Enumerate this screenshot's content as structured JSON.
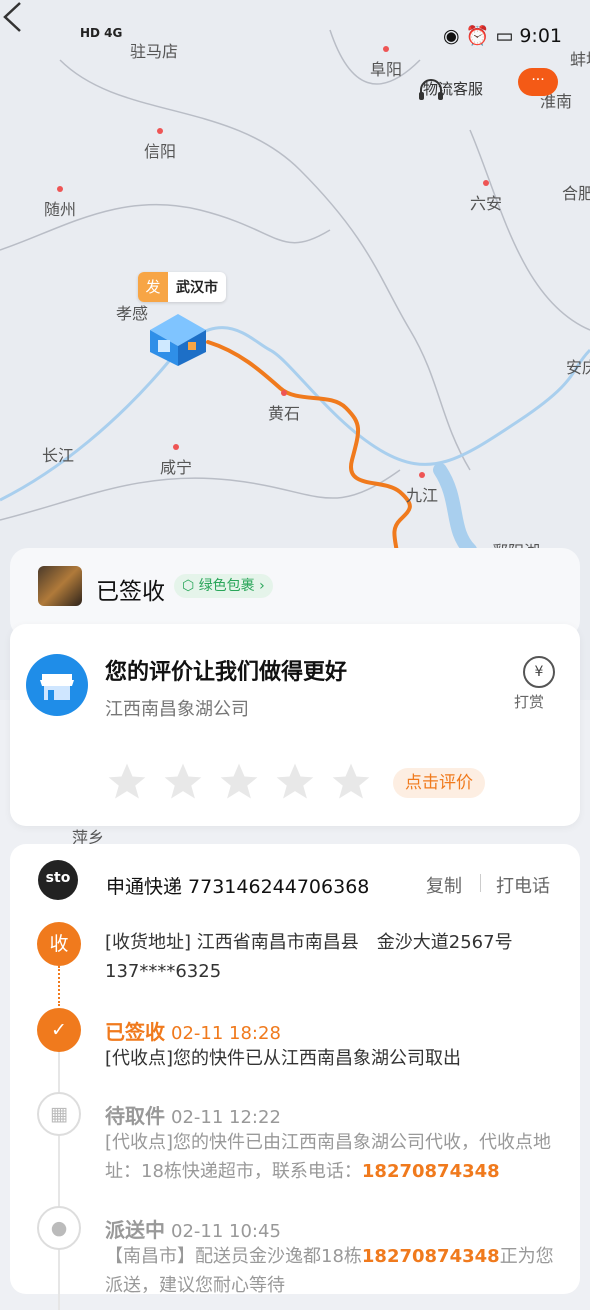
{
  "status_bar": {
    "left_icons": "HD 4G",
    "time": "9:01"
  },
  "map": {
    "cities": [
      {
        "name": "驻马店"
      },
      {
        "name": "阜阳"
      },
      {
        "name": "蚌埠"
      },
      {
        "name": "淮南"
      },
      {
        "name": "信阳"
      },
      {
        "name": "随州"
      },
      {
        "name": "六安"
      },
      {
        "name": "合肥"
      },
      {
        "name": "孝感"
      },
      {
        "name": "安庆"
      },
      {
        "name": "黄石"
      },
      {
        "name": "长江"
      },
      {
        "name": "咸宁"
      },
      {
        "name": "九江"
      },
      {
        "name": "鄱阳湖"
      },
      {
        "name": "萍乡"
      }
    ],
    "origin_badge": "发",
    "origin_city": "武汉市",
    "route_color": "#f07a1d"
  },
  "header": {
    "service_label": "物流客服",
    "more_label": "···"
  },
  "signed": {
    "status": "已签收",
    "green_badge": "绿色包裹"
  },
  "evaluation": {
    "title": "您的评价让我们做得更好",
    "company": "江西南昌象湖公司",
    "tip_symbol": "¥",
    "tip_label": "打赏",
    "rating_stars": 5,
    "rating_value": 0,
    "rate_button": "点击评价"
  },
  "tracking": {
    "carrier_logo": "sto",
    "carrier_line": "申通快递 773146244706368",
    "copy_label": "复制",
    "call_label": "打电话",
    "receive_badge": "收",
    "address": "[收货地址] 江西省南昌市南昌县　金沙大道2567号",
    "phone": "137****6325",
    "events": [
      {
        "status": "已签收",
        "time": "02-11  18:28",
        "text": "[代收点]您的快件已从江西南昌象湖公司取出",
        "highlight": ""
      },
      {
        "status": "待取件",
        "time": "02-11  12:22",
        "text": "[代收点]您的快件已由江西南昌象湖公司代收，代收点地址：18栋快递超市，联系电话：",
        "highlight": "18270874348"
      },
      {
        "status": "派送中",
        "time": "02-11  10:45",
        "text": "【南昌市】配送员金沙逸都18栋",
        "highlight": "18270874348",
        "text_after": "正为您派送，建议您耐心等待"
      }
    ]
  }
}
